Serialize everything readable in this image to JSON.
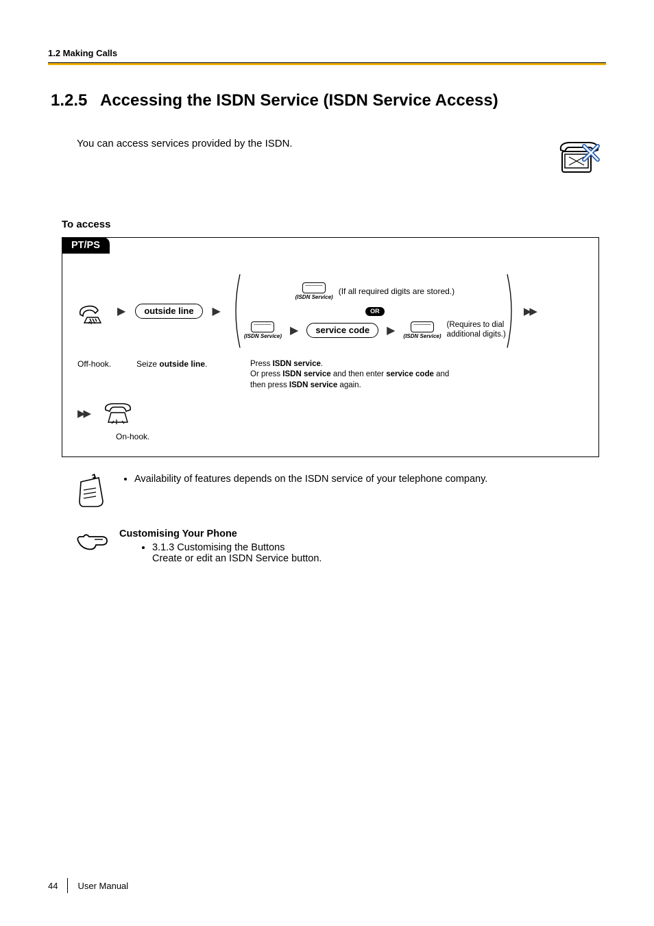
{
  "header": {
    "section": "1.2 Making Calls"
  },
  "title": {
    "number": "1.2.5",
    "text": "Accessing the ISDN Service (ISDN Service Access)"
  },
  "intro": "You can access services provided by the ISDN.",
  "subhead": "To access",
  "procedure": {
    "tab": "PT/PS",
    "outside_line": "outside line",
    "isdn_caption": "(ISDN Service)",
    "or": "OR",
    "service_code": "service code",
    "note_all_stored": "(If all required digits are stored.)",
    "note_requires1": "(Requires to dial",
    "note_requires2": "additional digits.)",
    "cap_offhook": "Off-hook.",
    "cap_seize_pre": "Seize ",
    "cap_seize_bold": "outside line",
    "cap_seize_post": ".",
    "cap_press_line1_pre": "Press ",
    "cap_press_line1_bold": "ISDN service",
    "cap_press_line1_post": ".",
    "cap_press_line2_pre": "Or press ",
    "cap_press_line2_bold1": "ISDN service",
    "cap_press_line2_mid": " and then enter ",
    "cap_press_line2_bold2": "service code",
    "cap_press_line2_post": " and",
    "cap_press_line3_pre": "then press ",
    "cap_press_line3_bold": "ISDN service",
    "cap_press_line3_post": " again.",
    "cap_onhook": "On-hook."
  },
  "note_bullet": "Availability of features depends on the ISDN service of your telephone company.",
  "ref": {
    "heading": "Customising Your Phone",
    "item": "3.1.3 Customising the Buttons",
    "sub": "Create or edit an ISDN Service button."
  },
  "footer": {
    "page": "44",
    "label": "User Manual"
  }
}
